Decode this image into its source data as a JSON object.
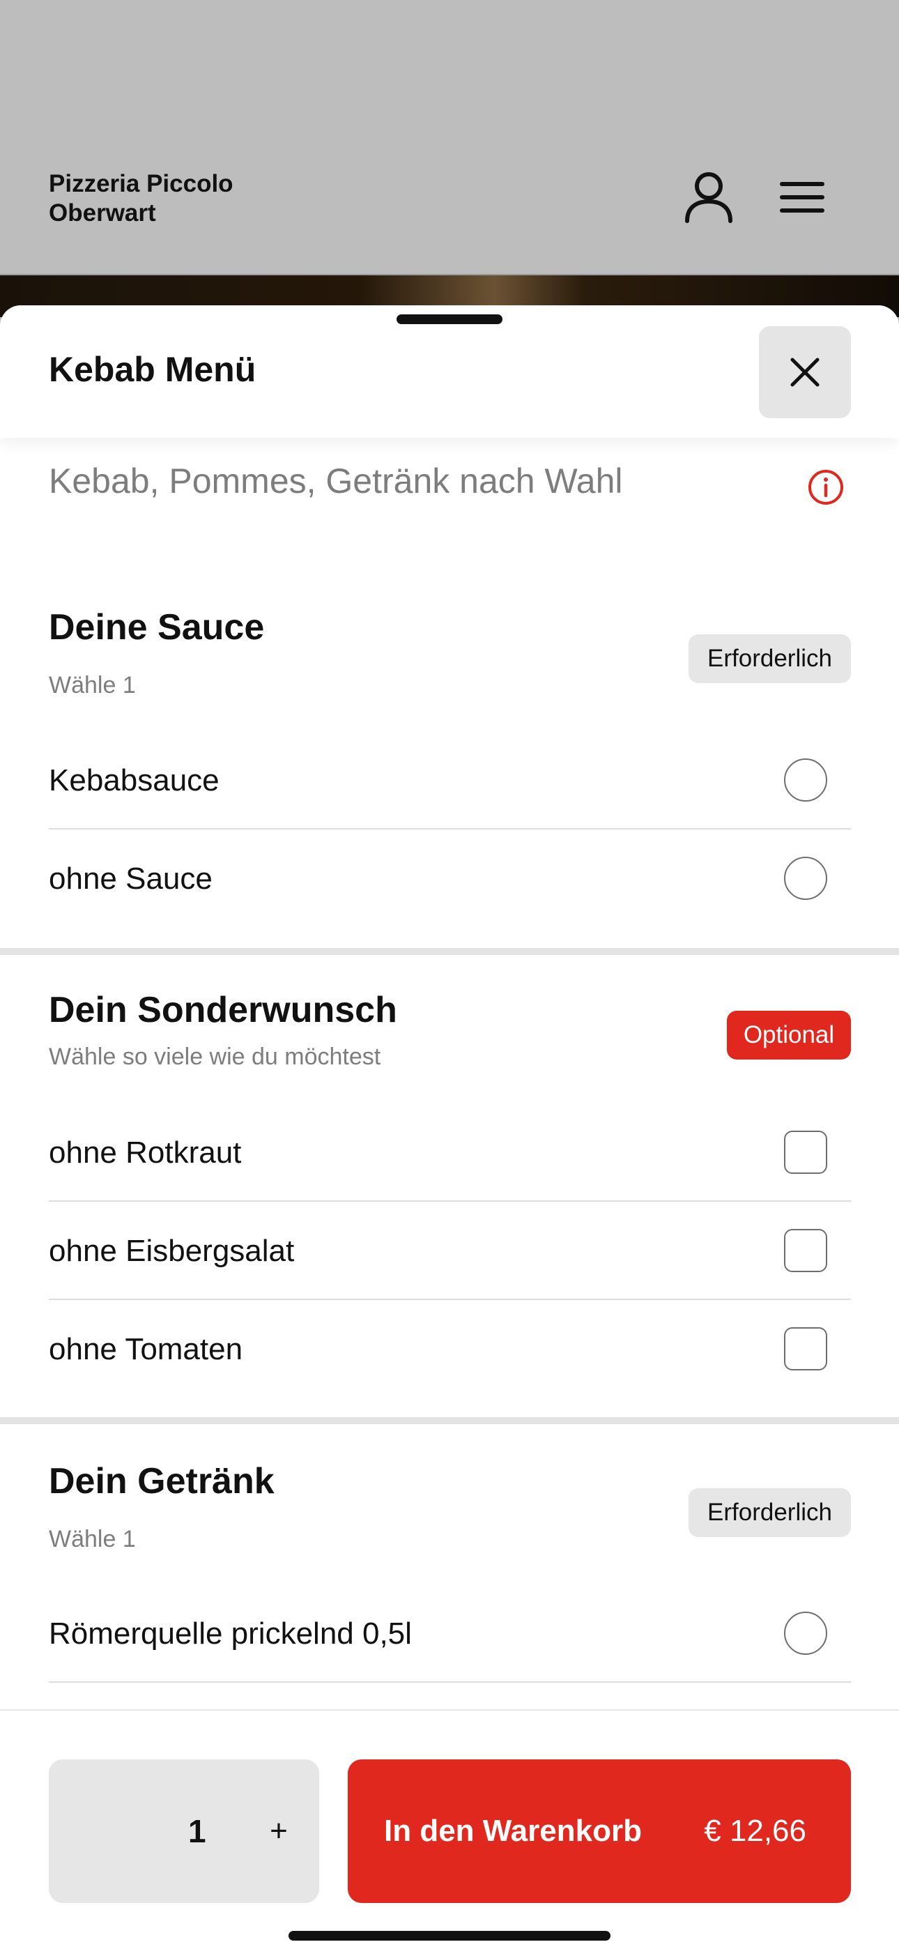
{
  "header": {
    "shop_name_line1": "Pizzeria Piccolo",
    "shop_name_line2": "Oberwart",
    "user_icon": "user-icon",
    "menu_icon": "hamburger-menu-icon"
  },
  "sheet": {
    "title": "Kebab Menü",
    "close_icon": "close-icon",
    "description": "Kebab, Pommes, Getränk nach Wahl",
    "info_icon": "info-icon"
  },
  "sections": [
    {
      "title": "Deine Sauce",
      "subtitle": "Wähle 1",
      "badge": "Erforderlich",
      "control": "radio",
      "options": [
        "Kebabsauce",
        "ohne Sauce"
      ]
    },
    {
      "title": "Dein Sonderwunsch",
      "subtitle": "Wähle so viele wie du möchtest",
      "badge": "Optional",
      "control": "checkbox",
      "options": [
        "ohne Rotkraut",
        "ohne Eisbergsalat",
        "ohne Tomaten"
      ]
    },
    {
      "title": "Dein Getränk",
      "subtitle": "Wähle 1",
      "badge": "Erforderlich",
      "control": "radio",
      "options": [
        "Römerquelle prickelnd 0,5l"
      ]
    }
  ],
  "footer": {
    "quantity": "1",
    "plus": "+",
    "cart_label": "In den Warenkorb",
    "price": "€ 12,66"
  },
  "colors": {
    "accent": "#e0281e",
    "badge_required_bg": "#e6e6e6",
    "header_bg": "#bdbdbd"
  }
}
